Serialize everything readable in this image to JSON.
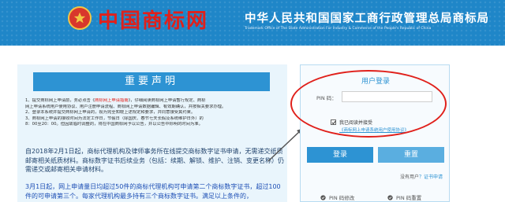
{
  "header": {
    "logo_text": "中国商标网",
    "org_name_cn": "中华人民共和国国家工商行政管理总局商标局",
    "org_name_en": "Trademark Office of The State Administration For Industry & Commerce of the People's Republic of China",
    "emblem_icon": "national-emblem-icon"
  },
  "notice": {
    "title": "重要声明",
    "items": [
      {
        "text_before": "1、提交商标网上申请前，务必点击《",
        "highlight": "商标网上申请指南",
        "text_after": "》，仔细阅读商标网上申请暂行规定、商标"
      },
      {
        "text_before": "网上申请系统用户使用协议、用户注册申请流程、商标网上申请数据编辑、有效期确认，并按相关要求办理。",
        "highlight": "",
        "text_after": ""
      },
      {
        "text_before": "2、登录本系统并提交商标网上申请的，视为完全知晓上述规定和要求，并同意接受其约束。",
        "highlight": "",
        "text_after": ""
      },
      {
        "text_before": "3、商标网上申请的接收时间为法定工作日，节假日（除国庆、春节七天长假及系统维护日外）的",
        "highlight": "",
        "text_after": ""
      },
      {
        "text_before": "8：00至20：00。但因故临时调整的，将在中国商标网予以公告，并以公告中标明的时间为准。",
        "highlight": "",
        "text_after": ""
      }
    ],
    "para1": "自2018年2月1日起，商标代理机构及律师事务所在线提交商标数字证书申请，无需递交纸质邮寄相关纸质材料。商标数字证书后续业务（包括：续期、解锁、维护、注销、变更名称）仍需递交或邮寄相关申请材料。",
    "para2": "3月1日起，网上申请量日均超过50件的商标代理机构可申请第二个商标数字证书，超过100件的可申请第三个。每家代理机构最多持有三个商标数字证书。满足以上条件的，"
  },
  "login": {
    "title": "用户登录",
    "pin_label": "PIN 码：",
    "pin_value": "",
    "pin_placeholder": "",
    "agree_checked": true,
    "agree_text": "我已阅读并接受",
    "agree_link": "《商标网上申请系统用户使用协议》",
    "login_button": "登录",
    "reset_button": "重置",
    "no_cert_text": "没有用户",
    "no_cert_link": "？证书申请",
    "pin_edit_label": "PIN 码修改",
    "pin_reset_label": "PIN 码重置"
  },
  "colors": {
    "header_blue": "#1f86c8",
    "accent_blue": "#2d93d3",
    "logo_red": "#e0201b",
    "annotation_red": "#e0201b"
  }
}
